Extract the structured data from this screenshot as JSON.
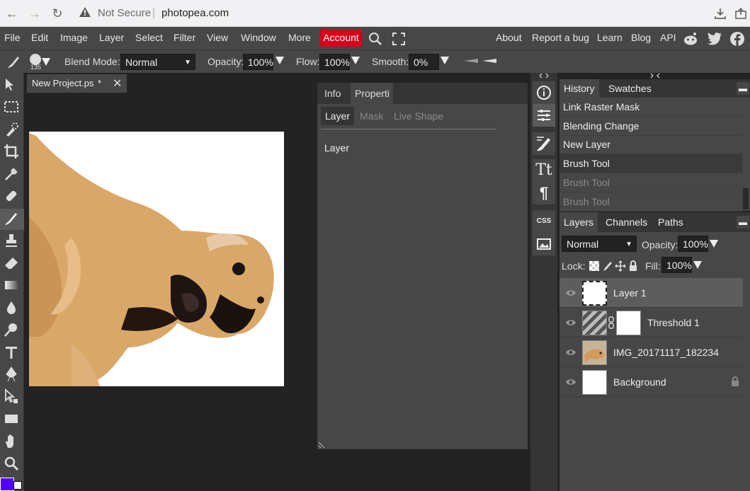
{
  "browser": {
    "security_label": "Not Secure",
    "separator": "|",
    "url": "photopea.com"
  },
  "menubar": {
    "items": [
      "File",
      "Edit",
      "Image",
      "Layer",
      "Select",
      "Filter",
      "View",
      "Window",
      "More"
    ],
    "account": "Account",
    "right_items": [
      "About",
      "Report a bug",
      "Learn",
      "Blog",
      "API"
    ]
  },
  "options": {
    "brush_size": "135",
    "blend_mode_label": "Blend Mode:",
    "blend_mode_value": "Normal",
    "opacity_label": "Opacity:",
    "opacity_value": "100%",
    "flow_label": "Flow:",
    "flow_value": "100%",
    "smooth_label": "Smooth:",
    "smooth_value": "0%"
  },
  "document": {
    "tab_title": "New Project.ps",
    "tab_modified": "*"
  },
  "properties": {
    "tabs": [
      "Info",
      "Properti"
    ],
    "subtabs": [
      "Layer",
      "Mask",
      "Live Shape"
    ],
    "content_label": "Layer"
  },
  "mini": {
    "css_label": "CSS",
    "text_label": "Tt",
    "para_label": "¶"
  },
  "history": {
    "tabs": [
      "History",
      "Swatches"
    ],
    "items": [
      "Link Raster Mask",
      "Blending Change",
      "New Layer",
      "Brush Tool",
      "Brush Tool",
      "Brush Tool"
    ]
  },
  "layers": {
    "tabs": [
      "Layers",
      "Channels",
      "Paths"
    ],
    "blend_value": "Normal",
    "opacity_label": "Opacity:",
    "opacity_value": "100%",
    "lock_label": "Lock:",
    "fill_label": "Fill:",
    "fill_value": "100%",
    "items": [
      "Layer 1",
      "Threshold 1",
      "IMG_20171117_182234",
      "Background"
    ]
  },
  "colors": {
    "accent": "#d9001b",
    "foreground_swatch": "#5400ff"
  }
}
